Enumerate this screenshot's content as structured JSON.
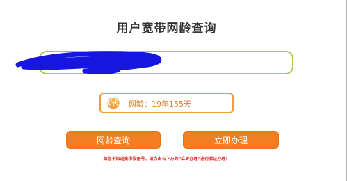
{
  "header": {
    "title": "用户宽带网龄查询"
  },
  "account_field": {
    "value": "",
    "redacted": true
  },
  "result": {
    "icon": "broadcast-icon",
    "text": "网龄：19年155天"
  },
  "buttons": {
    "query_label": "网龄查询",
    "handle_label": "立即办理"
  },
  "notice": {
    "text": "如您不知道宽带设备号，请点击右下方的“立即办理”进行验证办理！"
  },
  "colors": {
    "accent": "#f37d22",
    "input_border": "#a6c94a",
    "notice": "#e0251b",
    "redaction": "#1616e0"
  }
}
